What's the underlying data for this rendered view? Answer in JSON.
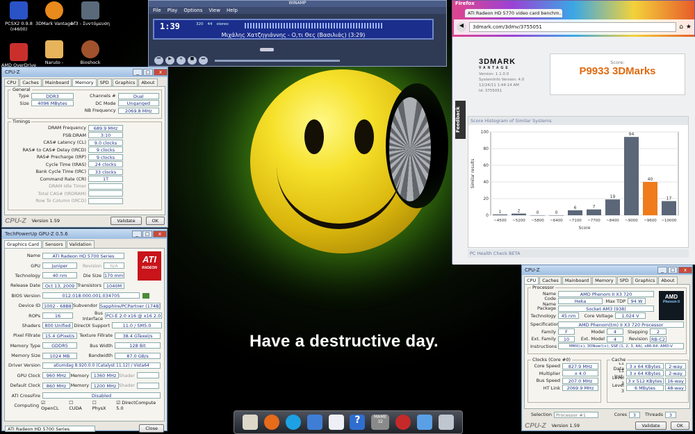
{
  "desktop": {
    "slogan": "Have a destructive day.",
    "icons": [
      {
        "label": "PCSX2 0.9.8 (r4600)",
        "color": "#2a53c8"
      },
      {
        "label": "3DMark Vantage",
        "color": "#e88a1c"
      },
      {
        "label": "bf3 - Συντόμευση",
        "color": "#5a6a7a"
      },
      {
        "label": "AMD OverDrive",
        "color": "#c9302c"
      },
      {
        "label": "Naruto -",
        "color": "#e7b45b"
      },
      {
        "label": "Bioshock",
        "color": "#a0522d"
      }
    ]
  },
  "winamp": {
    "title": "WINAMP",
    "menu": [
      "File",
      "Play",
      "Options",
      "View",
      "Help"
    ],
    "time": "1:39",
    "track": "Μιχάλης Χατζηγιάννης - Ο,τι Θες (Βασιλιάς) (3:29)",
    "kbps": "320",
    "khz": "44",
    "mode": "stereo"
  },
  "cpuz_mem": {
    "title": "CPU-Z",
    "tabs": [
      "CPU",
      "Caches",
      "Mainboard",
      "Memory",
      "SPD",
      "Graphics",
      "About"
    ],
    "active_tab": "Memory",
    "general_label": "General",
    "type_label": "Type",
    "type": "DDR3",
    "size_label": "Size",
    "size": "4096 MBytes",
    "channels_label": "Channels #",
    "channels": "Dual",
    "dc_label": "DC Mode",
    "dc_mode": "Unganged",
    "nb_label": "NB Frequency",
    "nb_freq": "2069.8 MHz",
    "timings_label": "Timings",
    "timings": [
      {
        "label": "DRAM Frequency",
        "value": "689.9 MHz"
      },
      {
        "label": "FSB:DRAM",
        "value": "3:10"
      },
      {
        "label": "CAS# Latency (CL)",
        "value": "9.0 clocks"
      },
      {
        "label": "RAS# to CAS# Delay (tRCD)",
        "value": "9 clocks"
      },
      {
        "label": "RAS# Precharge (tRP)",
        "value": "9 clocks"
      },
      {
        "label": "Cycle Time (tRAS)",
        "value": "24 clocks"
      },
      {
        "label": "Bank Cycle Time (tRC)",
        "value": "33 clocks"
      },
      {
        "label": "Command Rate (CR)",
        "value": "1T"
      }
    ],
    "dim_timings": [
      "DRAM Idle Timer",
      "Total CAS# (tRDRAM)",
      "Row To Column (tRCD)"
    ],
    "brand": "CPU-Z",
    "version": "Version 1.59",
    "validate": "Validate",
    "ok": "OK"
  },
  "gpuz": {
    "title": "TechPowerUp GPU-Z 0.5.6",
    "tabs": [
      "Graphics Card",
      "Sensors",
      "Validation"
    ],
    "logo": "ATI",
    "logo_sub": "RADEON",
    "rows": [
      {
        "l1": "Name",
        "v1": "ATI Radeon HD 5700 Series",
        "l2": "",
        "v2": ""
      },
      {
        "l1": "GPU",
        "v1": "Juniper",
        "l2": "Revision",
        "v2": "N/A"
      },
      {
        "l1": "Technology",
        "v1": "40 nm",
        "l2": "Die Size",
        "v2": "170 mm²"
      },
      {
        "l1": "Release Date",
        "v1": "Oct 13, 2009",
        "l2": "Transistors",
        "v2": "1040M"
      },
      {
        "l1": "BIOS Version",
        "v1": "012.018.000.001.034705",
        "l2": "",
        ":v2": ""
      },
      {
        "l1": "Device ID",
        "v1": "1002 - 68B8",
        "l2": "Subvendor",
        "v2": "Sapphire/PCPartner (174B)"
      },
      {
        "l1": "ROPs",
        "v1": "16",
        "l2": "Bus Interface",
        "v2": "PCI-E 2.0 x16 @ x16 2.0"
      },
      {
        "l1": "Shaders",
        "v1": "800 Unified",
        "l2": "DirectX Support",
        "v2": "11.0 / SM5.0"
      },
      {
        "l1": "Pixel Fillrate",
        "v1": "15.4 GPixel/s",
        "l2": "Texture Fillrate",
        "v2": "38.4 GTexel/s"
      },
      {
        "l1": "Memory Type",
        "v1": "GDDR5",
        "l2": "Bus Width",
        "v2": "128 Bit"
      },
      {
        "l1": "Memory Size",
        "v1": "1024 MB",
        "l2": "Bandwidth",
        "v2": "87.0 GB/s"
      },
      {
        "l1": "Driver Version",
        "v1": "atiumdag 8.920.0.0 (Catalyst 11.12) / Vista64",
        "l2": "",
        "v2": ""
      },
      {
        "l1": "GPU Clock",
        "v1": "960 MHz",
        "l2": "Memory",
        "v2": "1360 MHz"
      },
      {
        "l1": "Default Clock",
        "v1": "860 MHz",
        "l2": "Memory",
        "v2": "1200 MHz"
      },
      {
        "l1": "ATI CrossFire",
        "v1": "Disabled",
        "l2": "",
        "v2": ""
      }
    ],
    "shader_label": "Shader",
    "computing_label": "Computing",
    "computing": [
      "OpenCL",
      "CUDA",
      "PhysX",
      "DirectCompute 5.0"
    ],
    "select": "ATI Radeon HD 5700 Series",
    "close": "Close"
  },
  "firefox": {
    "title": "Firefox",
    "tab": "ATI Radeon HD 5770 video card benchm...",
    "url": "3dmark.com/3dmv/3755051",
    "logo": "3DMARK",
    "logo_sub": "VANTAGE",
    "version": "Version: 1.1.0.0",
    "sysinfo": "SystemInfo Version: 4.0",
    "date": "12/24/11 1:44:14 AM",
    "id": "Id: 3755051",
    "score_label": "Score:",
    "score": "P9933 3DMarks",
    "feedback": "Feedback",
    "histogram_title": "Score Histogram of Similar Systems",
    "ylabel": "Similar results",
    "xlabel": "Score",
    "health": "PC Health Check BETA"
  },
  "cpuz_cpu": {
    "title": "CPU-Z",
    "tabs": [
      "CPU",
      "Caches",
      "Mainboard",
      "Memory",
      "SPD",
      "Graphics",
      "About"
    ],
    "active_tab": "CPU",
    "processor_label": "Processor",
    "name": "AMD Phenom II X3 720",
    "codename": "Heka",
    "maxtdp": "94 W",
    "package": "Socket AM3 (938)",
    "technology": "45 nm",
    "core_voltage": "1.024 V",
    "specification": "AMD Phenom(tm) II X3 720 Processor",
    "family": "F",
    "model": "4",
    "stepping": "2",
    "ext_family": "10",
    "ext_model": "4",
    "revision": "RB-C2",
    "instructions": "MMX(+), 3DNow!(+), SSE (1, 2, 3, 4A), x86-64, AMD-V",
    "clocks_label": "Clocks (Core #0)",
    "core_speed": "827.9 MHz",
    "multiplier": "x 4.0",
    "bus_speed": "207.0 MHz",
    "ht_link": "2069.9 MHz",
    "cache_label": "Cache",
    "l1d": "3 x 64 KBytes",
    "l1d_way": "2-way",
    "l1i": "3 x 64 KBytes",
    "l1i_way": "2-way",
    "l2": "3 x 512 KBytes",
    "l2_way": "16-way",
    "l3": "6 MBytes",
    "l3_way": "48-way",
    "selection_label": "Selection",
    "selection": "Processor #1",
    "cores_label": "Cores",
    "cores": "3",
    "threads_label": "Threads",
    "threads": "3",
    "brand": "CPU-Z",
    "version": "Version 1.59",
    "validate": "Validate",
    "ok": "OK",
    "amd_logo": "AMD",
    "amd_sub": "Phenom II"
  },
  "chart_data": {
    "type": "bar",
    "title": "Score Histogram of Similar Systems",
    "xlabel": "Score",
    "ylabel": "Similar results",
    "categories": [
      "~4500",
      "~5200",
      "~5800",
      "~6400",
      "~7100",
      "~7700",
      "~8400",
      "~9000",
      "~9600",
      "~10000"
    ],
    "values": [
      1,
      2,
      0,
      0,
      6,
      7,
      19,
      94,
      40,
      17
    ],
    "highlight_index": 8,
    "ylim": [
      0,
      100
    ],
    "yticks": [
      0,
      20,
      40,
      60,
      80,
      100
    ],
    "bar_color": "#5b6678",
    "highlight_color": "#ef7b1a"
  },
  "taskbar": {
    "items": [
      {
        "name": "notepad-icon",
        "color": "#dcd7c8"
      },
      {
        "name": "firefox-icon",
        "color": "#e66b1b"
      },
      {
        "name": "skype-icon",
        "color": "#1da1e4"
      },
      {
        "name": "explorer-icon",
        "color": "#3e7ed4"
      },
      {
        "name": "document-icon",
        "color": "#eef0f6"
      },
      {
        "name": "help-icon",
        "color": "#2f6ecf"
      },
      {
        "name": "mame-icon",
        "color": "#8a8a8a"
      },
      {
        "name": "eye-icon",
        "color": "#c52a2a"
      },
      {
        "name": "network-icon",
        "color": "#5aa0e6"
      },
      {
        "name": "tools-icon",
        "color": "#bfc6cf"
      }
    ],
    "mame_label": "MAME",
    "mame_num": "32"
  }
}
